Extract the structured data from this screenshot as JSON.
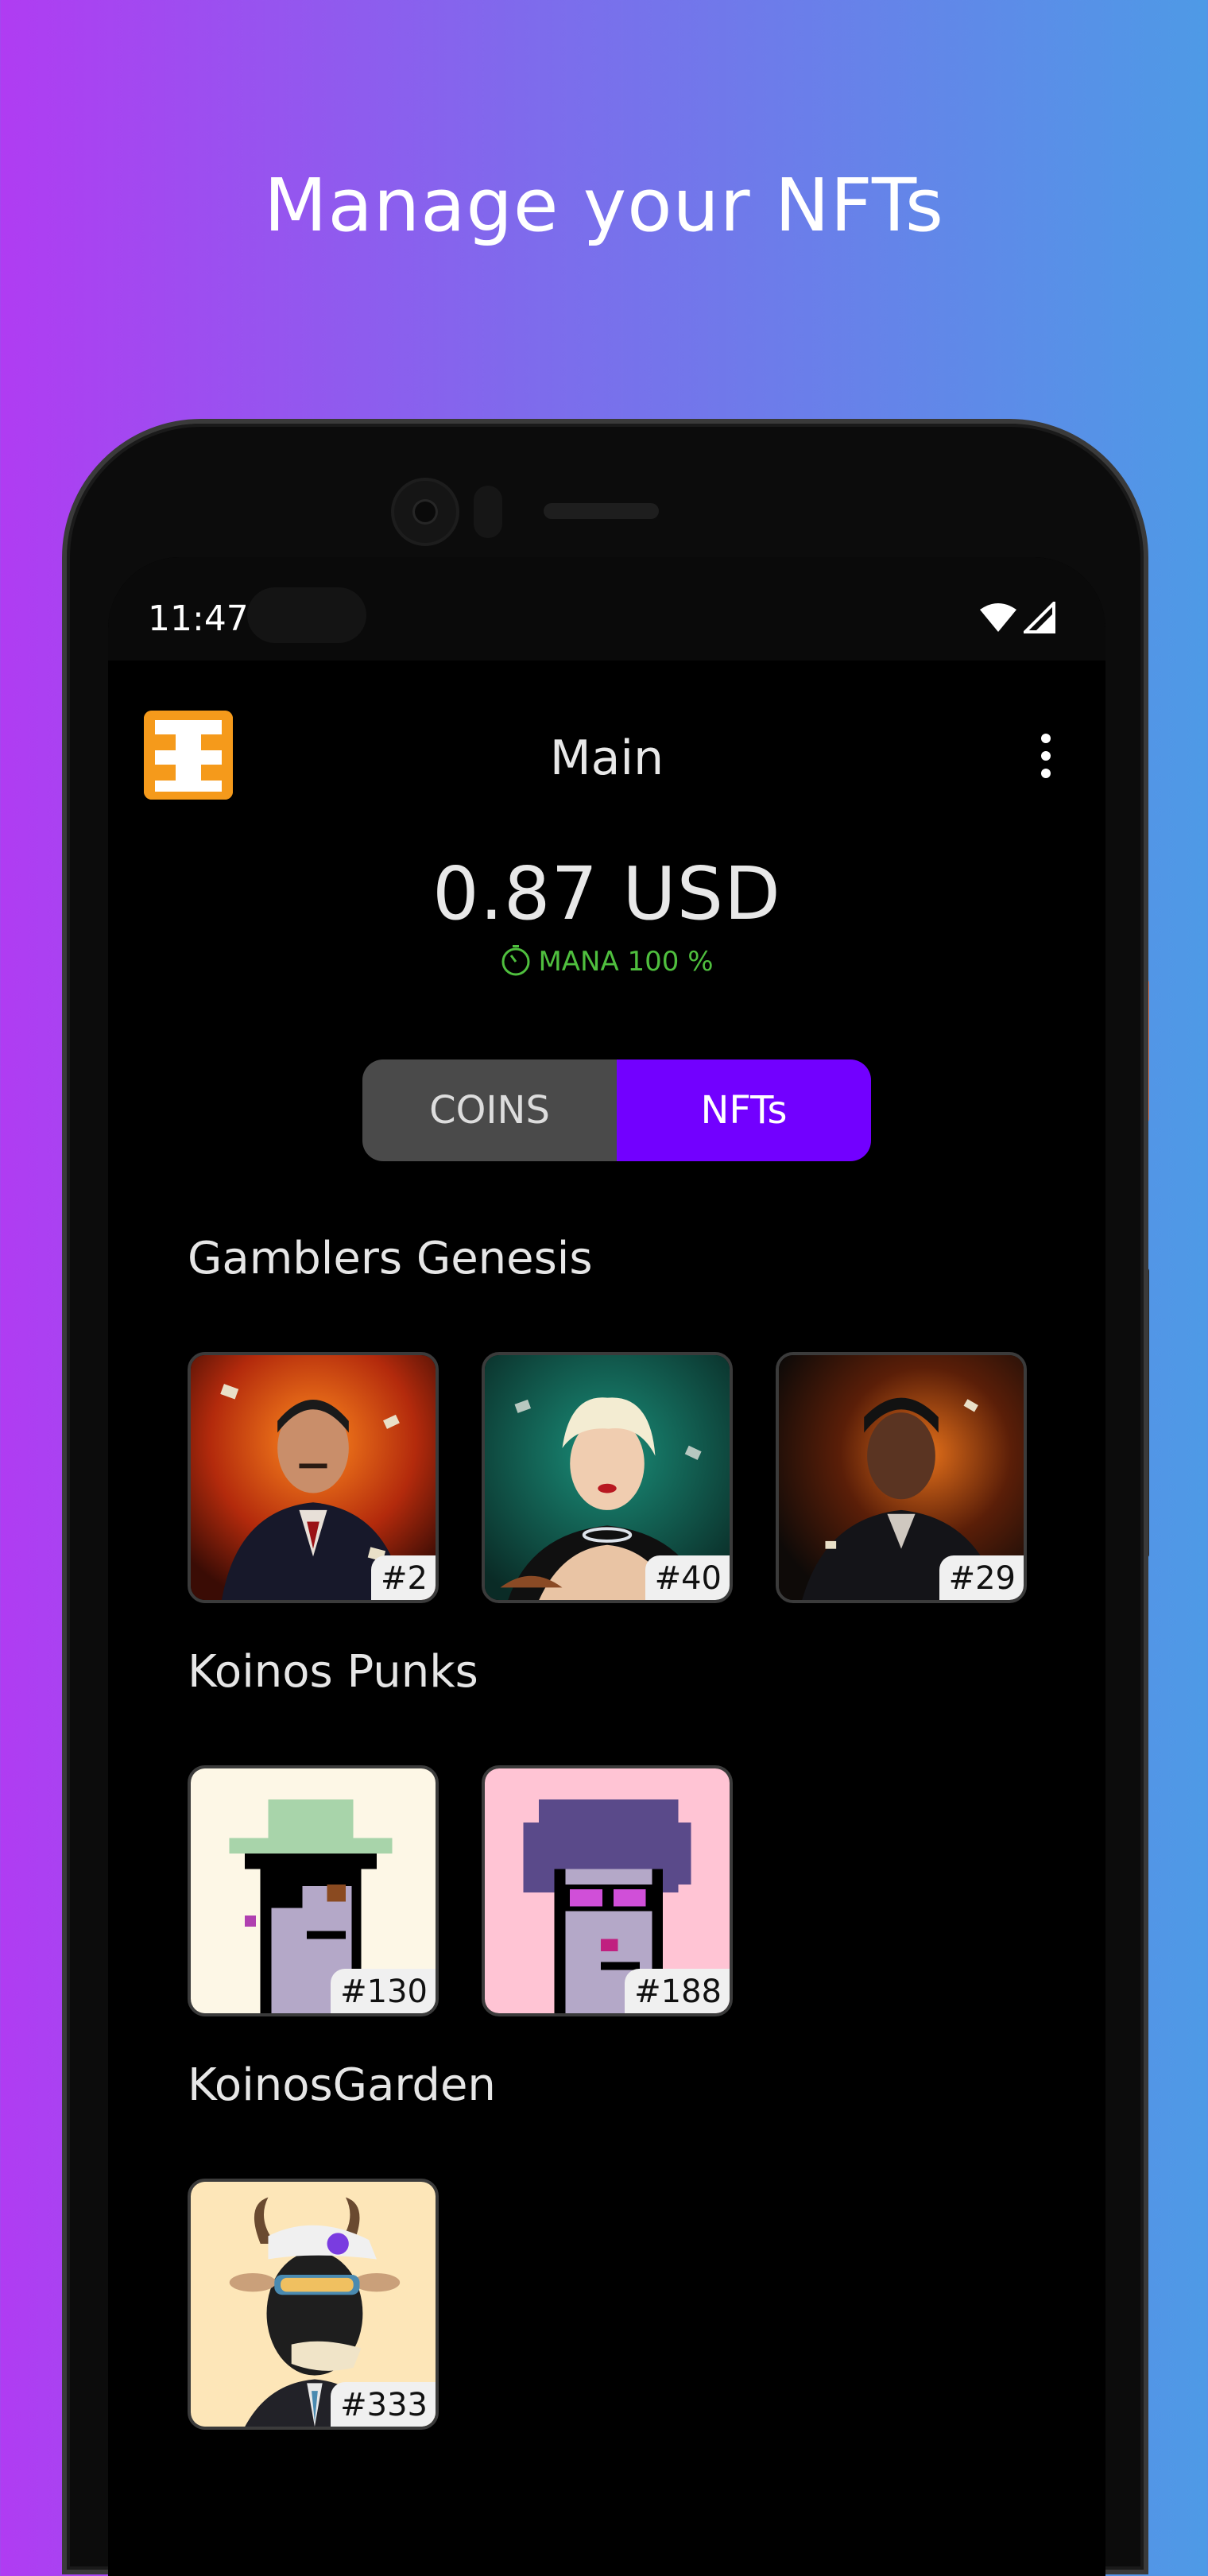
{
  "headline": "Manage your NFTs",
  "status_bar": {
    "time": "11:47"
  },
  "app_bar": {
    "title": "Main",
    "logo_color": "#f59a1b"
  },
  "balance": {
    "amount": "0.87 USD",
    "mana_label": "MANA 100 %",
    "mana_color": "#4fbf3e"
  },
  "tabs": [
    {
      "label": "COINS",
      "selected": false
    },
    {
      "label": "NFTs",
      "selected": true
    }
  ],
  "accent_color": "#7200ff",
  "collections": [
    {
      "name": "Gamblers Genesis",
      "items": [
        {
          "id": "#2"
        },
        {
          "id": "#40"
        },
        {
          "id": "#29"
        }
      ]
    },
    {
      "name": "Koinos Punks",
      "items": [
        {
          "id": "#130"
        },
        {
          "id": "#188"
        }
      ]
    },
    {
      "name": "KoinosGarden",
      "items": [
        {
          "id": "#333"
        }
      ]
    }
  ]
}
